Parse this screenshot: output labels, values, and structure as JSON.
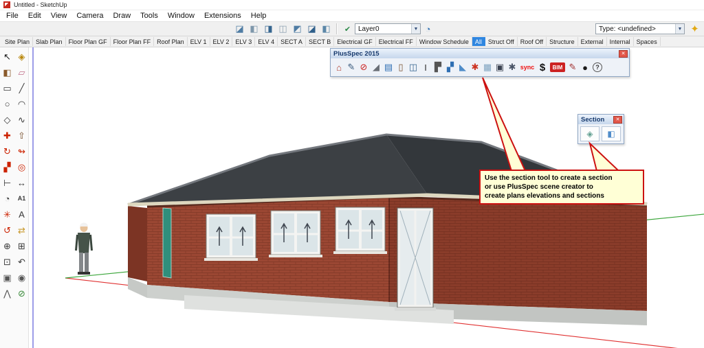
{
  "window": {
    "title": "Untitled - SketchUp"
  },
  "menus": [
    "File",
    "Edit",
    "View",
    "Camera",
    "Draw",
    "Tools",
    "Window",
    "Extensions",
    "Help"
  ],
  "topToolbar": {
    "viewIcons": [
      {
        "name": "standard-view-icon-1",
        "glyph": "◪",
        "color": "#4f7ca3"
      },
      {
        "name": "standard-view-icon-2",
        "glyph": "◧",
        "color": "#7e97ab"
      },
      {
        "name": "standard-view-icon-3",
        "glyph": "◨",
        "color": "#35658f"
      },
      {
        "name": "standard-view-icon-4",
        "glyph": "◫",
        "color": "#8fa3b2"
      },
      {
        "name": "standard-view-icon-5",
        "glyph": "◩",
        "color": "#4f7ca3"
      },
      {
        "name": "standard-view-icon-6",
        "glyph": "◪",
        "color": "#2f5f8a"
      },
      {
        "name": "standard-view-icon-7",
        "glyph": "◧",
        "color": "#5b87a8"
      }
    ],
    "layerCheck": {
      "glyph": "✔",
      "color": "#2e8b4a"
    },
    "layerCombo": {
      "value": "Layer0"
    },
    "layerManager": {
      "glyph": "◔",
      "color": "#2f6fb3"
    },
    "typeCombo": {
      "value": "Type: <undefined>"
    },
    "dcIcon": {
      "glyph": "✦",
      "color": "#e2a913"
    },
    "dropdown_arrow": "▼"
  },
  "sceneTabs": {
    "active": "All",
    "tabs": [
      "Site Plan",
      "Slab Plan",
      "Floor Plan GF",
      "Floor Plan FF",
      "Roof Plan",
      "ELV 1",
      "ELV 2",
      "ELV 3",
      "ELV 4",
      "SECT A",
      "SECT B",
      "Electrical GF",
      "Electrical FF",
      "Window Schedule",
      "All",
      "Struct Off",
      "Roof Off",
      "Structure",
      "External",
      "Internal",
      "Spaces"
    ]
  },
  "toolPalette": {
    "tools": [
      {
        "name": "select-tool",
        "glyph": "↖",
        "color": "#1a1a1a"
      },
      {
        "name": "make-component-tool",
        "glyph": "◈",
        "color": "#b8860b"
      },
      {
        "name": "paint-bucket-tool",
        "glyph": "◧",
        "color": "#8a5a2a"
      },
      {
        "name": "eraser-tool",
        "glyph": "▱",
        "color": "#c2708a"
      },
      {
        "name": "rectangle-tool",
        "glyph": "▭",
        "color": "#3a3a3a"
      },
      {
        "name": "line-tool",
        "glyph": "╱",
        "color": "#3a3a3a"
      },
      {
        "name": "circle-tool",
        "glyph": "○",
        "color": "#3a3a3a"
      },
      {
        "name": "arc-tool",
        "glyph": "◠",
        "color": "#3a3a3a"
      },
      {
        "name": "polygon-tool",
        "glyph": "◇",
        "color": "#3a3a3a"
      },
      {
        "name": "freehand-tool",
        "glyph": "∿",
        "color": "#3a3a3a"
      },
      {
        "name": "move-tool",
        "glyph": "✚",
        "color": "#cc2200"
      },
      {
        "name": "push-pull-tool",
        "glyph": "⇧",
        "color": "#7a5230"
      },
      {
        "name": "rotate-tool",
        "glyph": "↻",
        "color": "#cc2200"
      },
      {
        "name": "follow-me-tool",
        "glyph": "↬",
        "color": "#cc2200"
      },
      {
        "name": "scale-tool",
        "glyph": "▞",
        "color": "#cc2200"
      },
      {
        "name": "offset-tool",
        "glyph": "◎",
        "color": "#cc2200"
      },
      {
        "name": "tape-measure-tool",
        "glyph": "⊢",
        "color": "#3a3a3a"
      },
      {
        "name": "dimension-tool",
        "glyph": "↔",
        "color": "#3a3a3a"
      },
      {
        "name": "protractor-tool",
        "glyph": "◔",
        "color": "#3a3a3a"
      },
      {
        "name": "text-tool",
        "glyph": "A1",
        "color": "#3a3a3a",
        "small": true
      },
      {
        "name": "axes-tool",
        "glyph": "✳",
        "color": "#cc2200"
      },
      {
        "name": "3d-text-tool",
        "glyph": "A",
        "color": "#3a3a3a"
      },
      {
        "name": "orbit-tool",
        "glyph": "↺",
        "color": "#cc2200"
      },
      {
        "name": "pan-tool",
        "glyph": "⇄",
        "color": "#c99a2e"
      },
      {
        "name": "zoom-tool",
        "glyph": "⊕",
        "color": "#3a3a3a"
      },
      {
        "name": "zoom-window-tool",
        "glyph": "⊞",
        "color": "#3a3a3a"
      },
      {
        "name": "zoom-extents-tool",
        "glyph": "⊡",
        "color": "#3a3a3a"
      },
      {
        "name": "previous-view-tool",
        "glyph": "↶",
        "color": "#3a3a3a"
      },
      {
        "name": "position-camera-tool",
        "glyph": "▣",
        "color": "#555555"
      },
      {
        "name": "look-around-tool",
        "glyph": "◉",
        "color": "#555555"
      },
      {
        "name": "walk-tool",
        "glyph": "⋀",
        "color": "#555555"
      },
      {
        "name": "section-plane-tool",
        "glyph": "⊘",
        "color": "#3a8a3a"
      }
    ]
  },
  "plusspec": {
    "title": "PlusSpec 2015",
    "close_glyph": "✕",
    "icons": [
      {
        "name": "plusspec-estimate-truck-icon",
        "glyph": "⌂",
        "color": "#b03a2a"
      },
      {
        "name": "plusspec-spec-document-icon",
        "glyph": "✎",
        "color": "#35567a"
      },
      {
        "name": "plusspec-key-icon",
        "glyph": "⊘",
        "color": "#cc2222"
      },
      {
        "name": "plusspec-roof-tool-icon",
        "glyph": "◢",
        "color": "#6a6f76"
      },
      {
        "name": "plusspec-ledger-icon",
        "glyph": "▤",
        "color": "#2f6fb3"
      },
      {
        "name": "plusspec-door-tool-icon",
        "glyph": "▯",
        "color": "#7a5230"
      },
      {
        "name": "plusspec-window-tool-icon",
        "glyph": "◫",
        "color": "#35658f"
      },
      {
        "name": "plusspec-column-tool-icon",
        "glyph": "I",
        "color": "#333333"
      },
      {
        "name": "plusspec-wall-tool-icon",
        "glyph": "▛",
        "color": "#555555"
      },
      {
        "name": "plusspec-stairs-tool-icon",
        "glyph": "▞",
        "color": "#2f6fb3"
      },
      {
        "name": "plusspec-ramp-tool-icon",
        "glyph": "◣",
        "color": "#4f8cc9"
      },
      {
        "name": "plusspec-scene-creator-icon",
        "glyph": "✱",
        "color": "#cc3322"
      },
      {
        "name": "plusspec-grid-icon",
        "glyph": "▦",
        "color": "#7fa3c0"
      },
      {
        "name": "plusspec-structure-box-icon",
        "glyph": "▣",
        "color": "#3a4150"
      },
      {
        "name": "plusspec-settings-gear-icon",
        "glyph": "✱",
        "color": "#4a5568"
      },
      {
        "name": "plusspec-sync-label",
        "glyph": "sync",
        "color": "#ee1111",
        "style": "textlabel"
      },
      {
        "name": "plusspec-cost-dollar-icon",
        "glyph": "$",
        "color": "#111111",
        "style": "big"
      },
      {
        "name": "plusspec-bim-icon",
        "glyph": "BIM",
        "color": "#ffffff",
        "style": "badge"
      },
      {
        "name": "plusspec-annotate-pencil-icon",
        "glyph": "✎",
        "color": "#a03030"
      },
      {
        "name": "plusspec-render-sphere-icon",
        "glyph": "●",
        "color": "#1a1a1a"
      },
      {
        "name": "plusspec-help-icon",
        "glyph": "?",
        "color": "#333333",
        "style": "circle"
      }
    ]
  },
  "sectionToolbar": {
    "title": "Section",
    "close_glyph": "✕",
    "icons": [
      {
        "name": "section-plane-tool-icon",
        "glyph": "◈",
        "color": "#5f9e8f"
      },
      {
        "name": "section-display-toggle-icon",
        "glyph": "◧",
        "color": "#4f8cc9"
      }
    ]
  },
  "callout": {
    "text": "Use the section tool to create a section\nor use PlusSpec scene creator to\ncreate plans elevations and sections",
    "border_color": "#cc1111",
    "fill_color": "#ffffd6"
  },
  "colors": {
    "active_tab": "#2f86e0",
    "axis_red": "#e03030",
    "axis_green": "#3aa53a",
    "axis_blue": "#3b3bd0",
    "brick": "#9b4733",
    "roof": "#3c4044"
  }
}
